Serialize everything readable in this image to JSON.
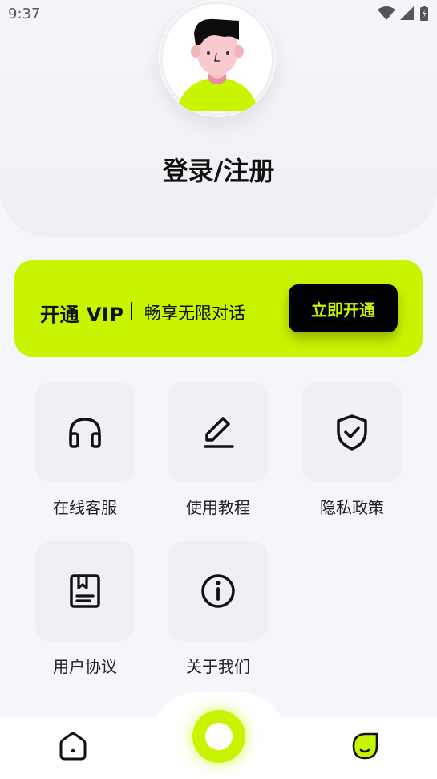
{
  "status_bar": {
    "time": "9:37"
  },
  "header": {
    "login_label": "登录/注册",
    "avatar_icon": "user-avatar-illustration"
  },
  "vip": {
    "title": "开通 VIP",
    "subtitle": "畅享无限对话",
    "button_label": "立即开通",
    "accent_color": "#c7f500"
  },
  "menu": {
    "items": [
      {
        "label": "在线客服",
        "icon": "headset-icon"
      },
      {
        "label": "使用教程",
        "icon": "pen-icon"
      },
      {
        "label": "隐私政策",
        "icon": "shield-check-icon"
      },
      {
        "label": "用户协议",
        "icon": "book-icon"
      },
      {
        "label": "关于我们",
        "icon": "info-icon"
      }
    ]
  },
  "tabbar": {
    "items": [
      "home-icon",
      "center-action",
      "profile-icon"
    ]
  }
}
